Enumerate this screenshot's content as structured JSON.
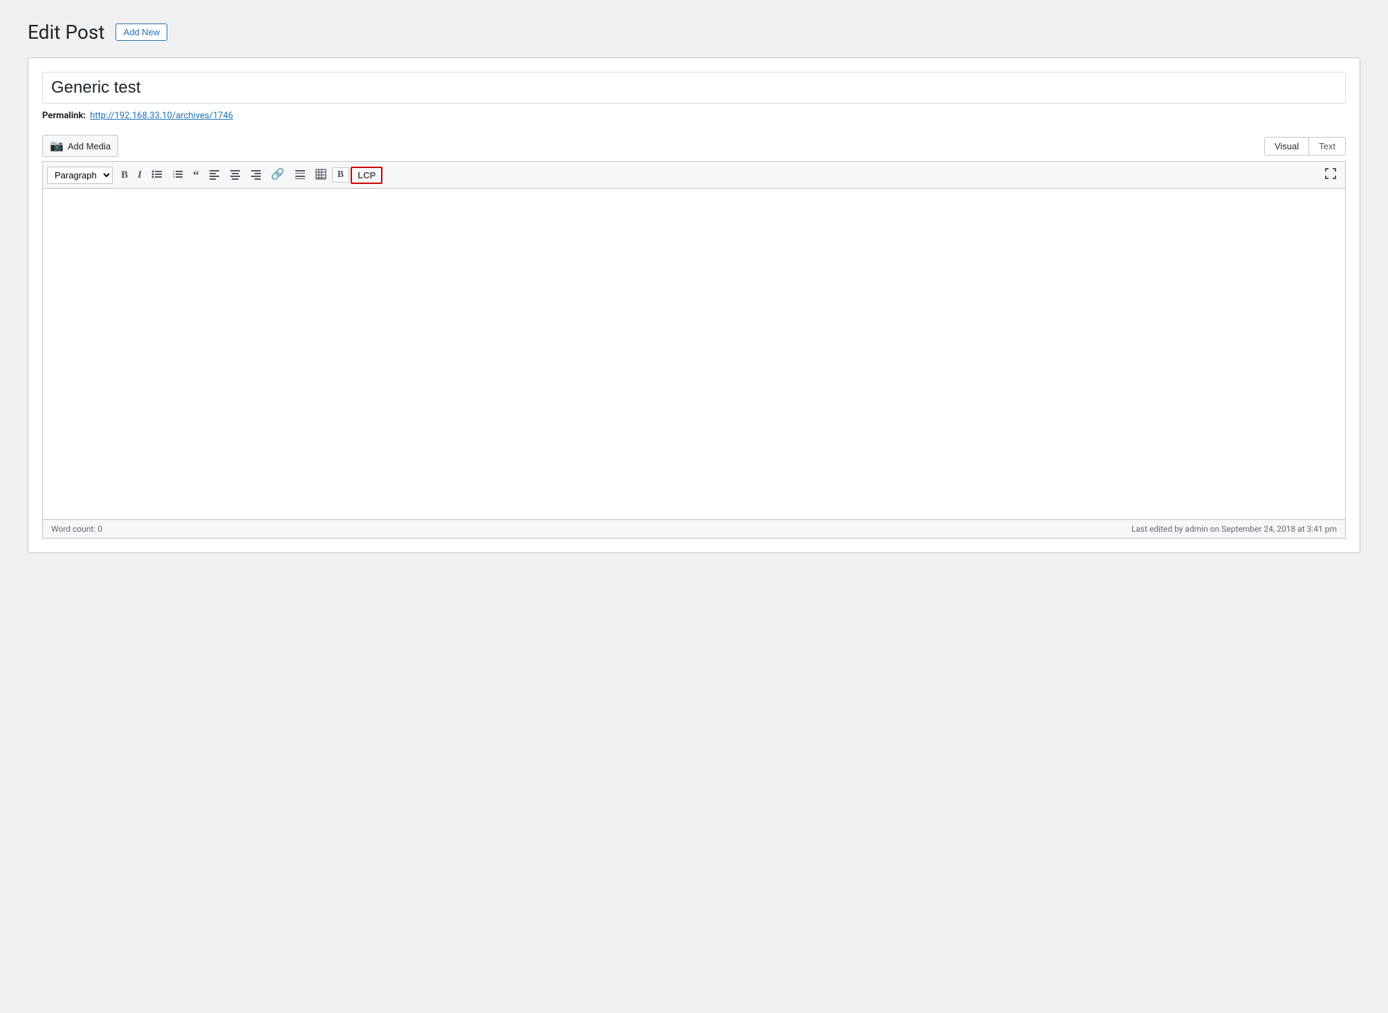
{
  "page": {
    "title": "Edit Post",
    "add_new_label": "Add New"
  },
  "post": {
    "title": "Generic test",
    "permalink_label": "Permalink:",
    "permalink_url": "http://192.168.33.10/archives/1746"
  },
  "editor": {
    "add_media_label": "Add Media",
    "visual_tab": "Visual",
    "text_tab": "Text",
    "paragraph_option": "Paragraph",
    "lcp_label": "LCP",
    "word_count_label": "Word count: 0",
    "last_edited": "Last edited by admin on September 24, 2018 at 3:41 pm"
  },
  "toolbar": {
    "bold": "B",
    "italic": "I",
    "ul": "≡",
    "ol": "≡",
    "blockquote": "❝",
    "align_left": "≡",
    "align_center": "≡",
    "align_right": "≡",
    "link": "🔗",
    "horizontal_rule": "—",
    "table": "⊞",
    "custom_b": "B",
    "fullscreen": "⤢"
  }
}
